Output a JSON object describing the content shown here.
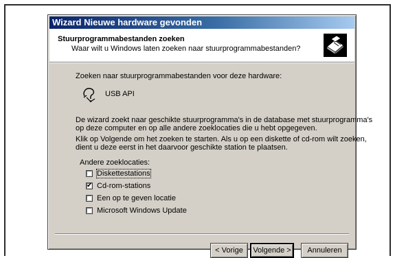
{
  "window": {
    "title": "Wizard Nieuwe hardware gevonden"
  },
  "header": {
    "title": "Stuurprogrammabestanden zoeken",
    "subtitle": "Waar wilt u Windows laten zoeken naar stuurprogrammabestanden?",
    "icon": "hardware-wizard-icon"
  },
  "body": {
    "search_for": "Zoeken naar stuurprogrammabestanden voor deze hardware:",
    "device_name": "USB API",
    "device_icon": "unknown-device-icon",
    "para1_line1": "De wizard zoekt naar geschikte stuurprogramma's in de database met stuurprogramma's",
    "para1_line2": "op deze computer en op alle andere zoeklocaties die u hebt opgegeven.",
    "para2_line1": "Klik op Volgende om het zoeken te starten. Als u op een diskette of cd-rom wilt zoeken,",
    "para2_line2": "dient u deze eerst in het daarvoor geschikte station te plaatsen.",
    "other_locations_label": "Andere zoeklocaties:"
  },
  "options": [
    {
      "label": "Diskettestations",
      "checked": false
    },
    {
      "label": "Cd-rom-stations",
      "checked": true
    },
    {
      "label": "Een op te geven locatie",
      "checked": false
    },
    {
      "label": "Microsoft Windows Update",
      "checked": false
    }
  ],
  "buttons": {
    "back": "< Vorige",
    "next": "Volgende >",
    "cancel": "Annuleren"
  }
}
